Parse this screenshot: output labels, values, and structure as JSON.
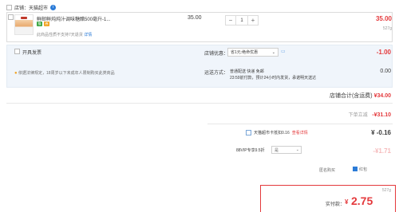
{
  "store": {
    "label": "店铺：天猫超市",
    "badge": "i"
  },
  "item": {
    "title": "鲜邮鲜炖炖汁调味糖醋500毫升-1...",
    "tag_a": "猫",
    "tag_b": "券",
    "note_text": "此商品性质不支持7天退货",
    "note_link": "详情",
    "unit_price": "35.00",
    "qty_minus": "−",
    "qty_value": "1",
    "qty_plus": "+",
    "price": "35.00",
    "weight": "527g"
  },
  "invoice": {
    "open_label": "开具发票",
    "legal_pin": "●",
    "legal_note": "依据法律规定，18周岁以下未成年人限制购买此类商品"
  },
  "promo": {
    "label": "店铺优惠：",
    "selected": "省1元:绝命优惠",
    "chevron": "⌄",
    "chat": "▭",
    "amount": "-1.00"
  },
  "shipping": {
    "label": "运送方式：",
    "line1": "普通配送 快递 免邮",
    "line2": "23:59前付款，预计24小时内发货，承诺明天送达",
    "amount": "0.00"
  },
  "store_total": {
    "label": "店铺合计(含运费)",
    "amount": "¥34.00"
  },
  "order_coupon": {
    "label": "下单立减",
    "amount": "-¥31.10"
  },
  "tmall_card": {
    "label": "天猫超市卡抵扣0.16",
    "link": "查看详情",
    "amount": "¥ -0.16"
  },
  "vip": {
    "label": "88VIP专享9.5折",
    "selected": "是",
    "chevron": "⌄",
    "amount": "-¥1.71"
  },
  "options": {
    "left": "匿名购买",
    "right": "红包"
  },
  "pay": {
    "weight": "527g",
    "label": "实付款：",
    "currency": "¥",
    "amount": "2.75"
  }
}
